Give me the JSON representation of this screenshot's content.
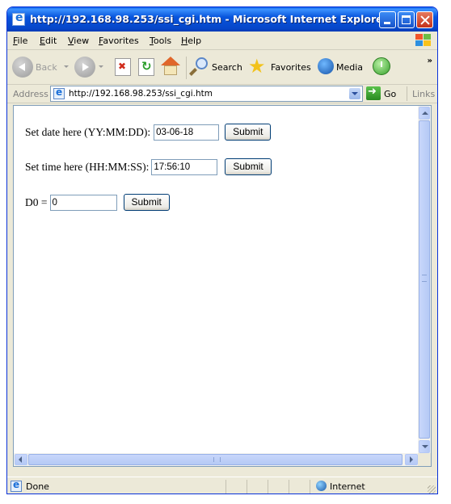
{
  "window": {
    "title": "http://192.168.98.253/ssi_cgi.htm - Microsoft Internet Explorer"
  },
  "menu": {
    "file": "File",
    "edit": "Edit",
    "view": "View",
    "favorites": "Favorites",
    "tools": "Tools",
    "help": "Help"
  },
  "toolbar": {
    "back": "Back",
    "search": "Search",
    "favorites": "Favorites",
    "media": "Media"
  },
  "address": {
    "label": "Address",
    "url": "http://192.168.98.253/ssi_cgi.htm",
    "go": "Go",
    "links": "Links"
  },
  "form": {
    "date_label": "Set date here (YY:MM:DD):",
    "date_value": "03-06-18",
    "time_label": "Set time here (HH:MM:SS):",
    "time_value": "17:56:10",
    "d0_label": "D0 =",
    "d0_value": "0",
    "submit_label": "Submit"
  },
  "status": {
    "text": "Done",
    "zone": "Internet"
  },
  "colors": {
    "titlebar": "#0855dd",
    "chrome": "#ece9d8",
    "scrollbar": "#c8d7fb"
  }
}
